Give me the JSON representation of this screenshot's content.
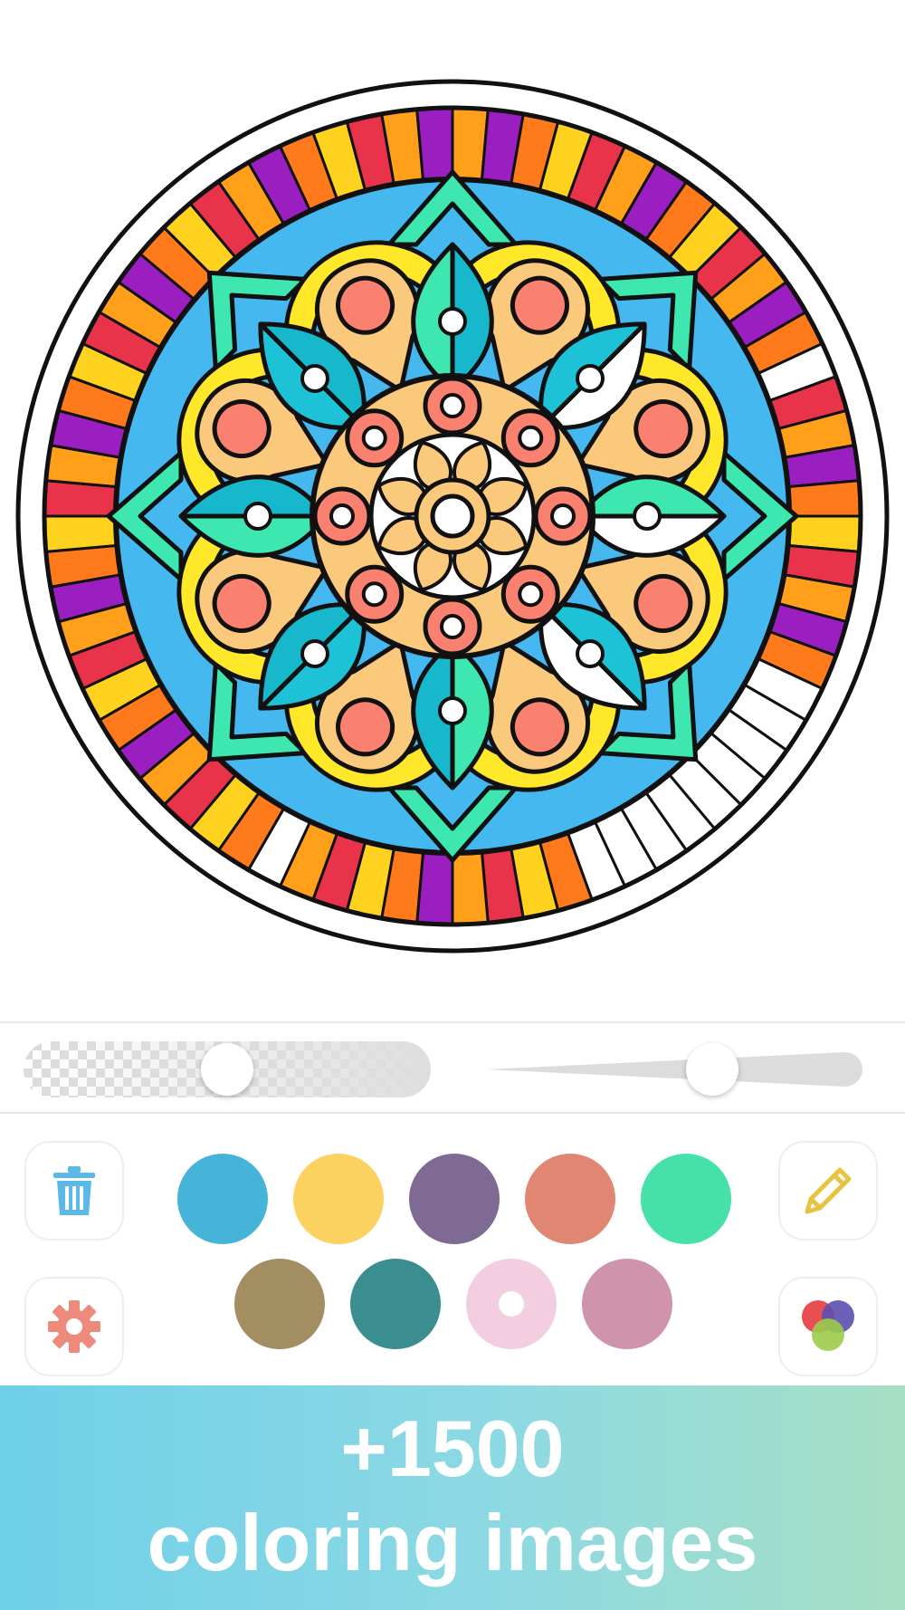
{
  "toolbar": {
    "opacity_value": 0.5,
    "brush_size_value": 0.6,
    "trash_icon": "trash-icon",
    "settings_icon": "gear-icon",
    "pencil_icon": "pencil-icon",
    "palettes_icon": "color-palettes-icon"
  },
  "palette": {
    "row1": [
      {
        "name": "blue",
        "color": "#46b4d8"
      },
      {
        "name": "yellow",
        "color": "#fbd160"
      },
      {
        "name": "purple",
        "color": "#7e6a92"
      },
      {
        "name": "salmon",
        "color": "#e28674"
      },
      {
        "name": "mint",
        "color": "#45e1a8"
      }
    ],
    "row2": [
      {
        "name": "olive",
        "color": "#a28e60"
      },
      {
        "name": "teal",
        "color": "#3b8e90"
      },
      {
        "name": "pink",
        "color": "#f3cde0",
        "selected": true
      },
      {
        "name": "mauve",
        "color": "#cf93ac"
      }
    ]
  },
  "promo": {
    "line1": "+1500",
    "line2": "coloring images"
  },
  "colors": {
    "accent_blue": "#5ab9e8",
    "gear": "#ee8a7b",
    "pencil": "#e8c342"
  }
}
